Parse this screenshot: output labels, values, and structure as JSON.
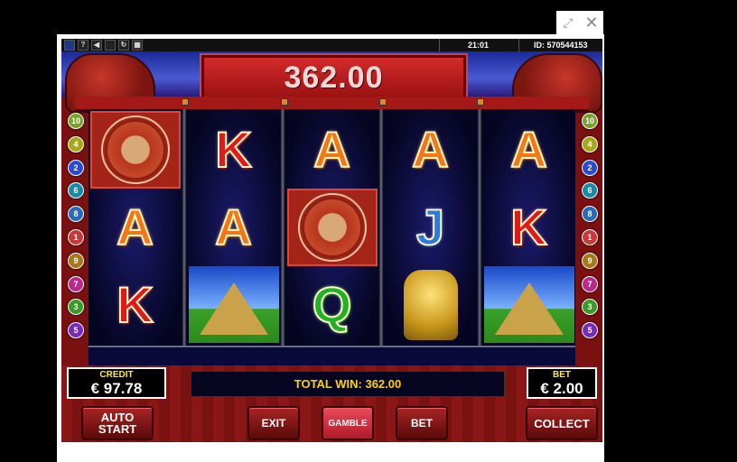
{
  "window": {
    "maximize_icon": "⤢",
    "close_icon": "✕"
  },
  "topbar": {
    "time": "21:01",
    "id_label": "ID: 570544153",
    "icons": [
      "flag-icon",
      "help-icon",
      "sound-icon",
      "screen-icon",
      "reload-icon",
      "info-icon"
    ],
    "help": "?"
  },
  "win": {
    "amount": "362.00"
  },
  "reels": [
    [
      "calendar",
      "A",
      "K"
    ],
    [
      "K",
      "A",
      "pyramid"
    ],
    [
      "A",
      "calendar",
      "Q"
    ],
    [
      "A",
      "J",
      "idol"
    ],
    [
      "A",
      "K",
      "pyramid"
    ]
  ],
  "paylines": {
    "left": [
      "10",
      "4",
      "2",
      "6",
      "8",
      "1",
      "9",
      "7",
      "3",
      "5"
    ],
    "right": [
      "10",
      "4",
      "2",
      "6",
      "8",
      "1",
      "9",
      "7",
      "3",
      "5"
    ]
  },
  "credit": {
    "label": "CREDIT",
    "value": "€ 97.78"
  },
  "total_win": "TOTAL WIN: 362.00",
  "bet": {
    "label": "BET",
    "value": "€ 2.00"
  },
  "buttons": {
    "auto_start_1": "AUTO",
    "auto_start_2": "START",
    "exit": "EXIT",
    "gamble": "GAMBLE",
    "bet": "BET",
    "collect": "COLLECT"
  },
  "colors": {
    "panel_red": "#7a1010",
    "win_yellow": "#ffd400"
  }
}
